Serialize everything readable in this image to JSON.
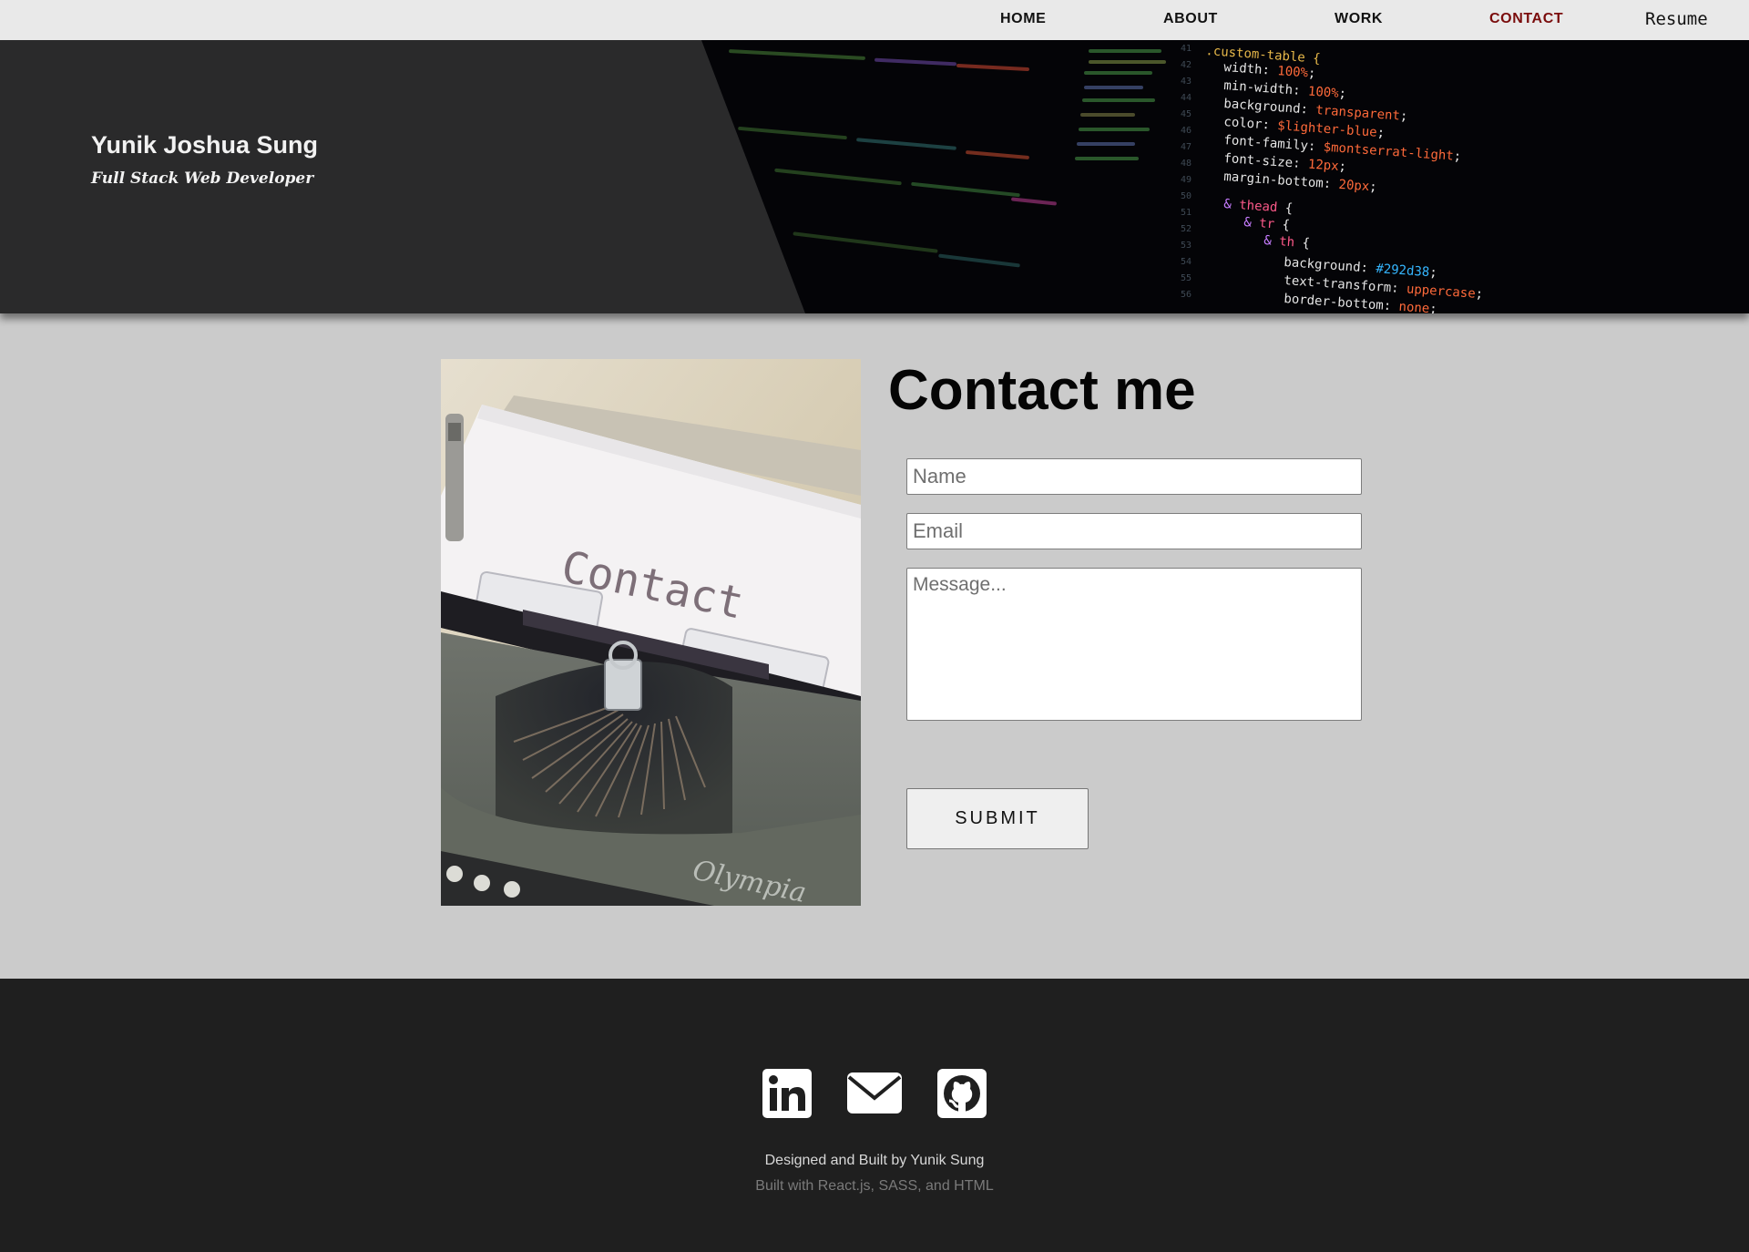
{
  "nav": {
    "items": [
      {
        "label": "HOME",
        "active": false
      },
      {
        "label": "ABOUT",
        "active": false
      },
      {
        "label": "WORK",
        "active": false
      },
      {
        "label": "CONTACT",
        "active": true
      }
    ],
    "resume_label": "Resume"
  },
  "hero": {
    "name": "Yunik Joshua Sung",
    "subtitle": "Full Stack Web Developer"
  },
  "contact": {
    "title": "Contact me",
    "image_text": "Contact",
    "name_placeholder": "Name",
    "name_value": "",
    "email_placeholder": "Email",
    "email_value": "",
    "message_placeholder": "Message...",
    "message_value": "",
    "submit_label": "SUBMIT"
  },
  "footer": {
    "icons": [
      "linkedin-icon",
      "email-icon",
      "github-icon"
    ],
    "credit": "Designed and Built by Yunik Sung",
    "built_with": "Built with React.js, SASS, and HTML"
  },
  "colors": {
    "nav_bg": "#e9e9e9",
    "nav_active": "#7a0c0c",
    "hero_bg": "#2a2a2b",
    "page_bg": "#cbcbcb",
    "footer_bg": "#1f1f1f"
  }
}
